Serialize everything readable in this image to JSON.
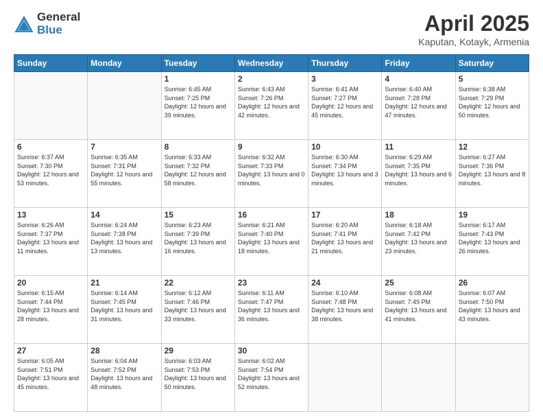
{
  "header": {
    "logo_general": "General",
    "logo_blue": "Blue",
    "title": "April 2025",
    "location": "Kaputan, Kotayk, Armenia"
  },
  "days_of_week": [
    "Sunday",
    "Monday",
    "Tuesday",
    "Wednesday",
    "Thursday",
    "Friday",
    "Saturday"
  ],
  "weeks": [
    [
      {
        "day": "",
        "info": ""
      },
      {
        "day": "",
        "info": ""
      },
      {
        "day": "1",
        "info": "Sunrise: 6:45 AM\nSunset: 7:25 PM\nDaylight: 12 hours and 39 minutes."
      },
      {
        "day": "2",
        "info": "Sunrise: 6:43 AM\nSunset: 7:26 PM\nDaylight: 12 hours and 42 minutes."
      },
      {
        "day": "3",
        "info": "Sunrise: 6:41 AM\nSunset: 7:27 PM\nDaylight: 12 hours and 45 minutes."
      },
      {
        "day": "4",
        "info": "Sunrise: 6:40 AM\nSunset: 7:28 PM\nDaylight: 12 hours and 47 minutes."
      },
      {
        "day": "5",
        "info": "Sunrise: 6:38 AM\nSunset: 7:29 PM\nDaylight: 12 hours and 50 minutes."
      }
    ],
    [
      {
        "day": "6",
        "info": "Sunrise: 6:37 AM\nSunset: 7:30 PM\nDaylight: 12 hours and 53 minutes."
      },
      {
        "day": "7",
        "info": "Sunrise: 6:35 AM\nSunset: 7:31 PM\nDaylight: 12 hours and 55 minutes."
      },
      {
        "day": "8",
        "info": "Sunrise: 6:33 AM\nSunset: 7:32 PM\nDaylight: 12 hours and 58 minutes."
      },
      {
        "day": "9",
        "info": "Sunrise: 6:32 AM\nSunset: 7:33 PM\nDaylight: 13 hours and 0 minutes."
      },
      {
        "day": "10",
        "info": "Sunrise: 6:30 AM\nSunset: 7:34 PM\nDaylight: 13 hours and 3 minutes."
      },
      {
        "day": "11",
        "info": "Sunrise: 6:29 AM\nSunset: 7:35 PM\nDaylight: 13 hours and 6 minutes."
      },
      {
        "day": "12",
        "info": "Sunrise: 6:27 AM\nSunset: 7:36 PM\nDaylight: 13 hours and 8 minutes."
      }
    ],
    [
      {
        "day": "13",
        "info": "Sunrise: 6:26 AM\nSunset: 7:37 PM\nDaylight: 13 hours and 11 minutes."
      },
      {
        "day": "14",
        "info": "Sunrise: 6:24 AM\nSunset: 7:38 PM\nDaylight: 13 hours and 13 minutes."
      },
      {
        "day": "15",
        "info": "Sunrise: 6:23 AM\nSunset: 7:39 PM\nDaylight: 13 hours and 16 minutes."
      },
      {
        "day": "16",
        "info": "Sunrise: 6:21 AM\nSunset: 7:40 PM\nDaylight: 13 hours and 18 minutes."
      },
      {
        "day": "17",
        "info": "Sunrise: 6:20 AM\nSunset: 7:41 PM\nDaylight: 13 hours and 21 minutes."
      },
      {
        "day": "18",
        "info": "Sunrise: 6:18 AM\nSunset: 7:42 PM\nDaylight: 13 hours and 23 minutes."
      },
      {
        "day": "19",
        "info": "Sunrise: 6:17 AM\nSunset: 7:43 PM\nDaylight: 13 hours and 26 minutes."
      }
    ],
    [
      {
        "day": "20",
        "info": "Sunrise: 6:15 AM\nSunset: 7:44 PM\nDaylight: 13 hours and 28 minutes."
      },
      {
        "day": "21",
        "info": "Sunrise: 6:14 AM\nSunset: 7:45 PM\nDaylight: 13 hours and 31 minutes."
      },
      {
        "day": "22",
        "info": "Sunrise: 6:12 AM\nSunset: 7:46 PM\nDaylight: 13 hours and 33 minutes."
      },
      {
        "day": "23",
        "info": "Sunrise: 6:11 AM\nSunset: 7:47 PM\nDaylight: 13 hours and 36 minutes."
      },
      {
        "day": "24",
        "info": "Sunrise: 6:10 AM\nSunset: 7:48 PM\nDaylight: 13 hours and 38 minutes."
      },
      {
        "day": "25",
        "info": "Sunrise: 6:08 AM\nSunset: 7:49 PM\nDaylight: 13 hours and 41 minutes."
      },
      {
        "day": "26",
        "info": "Sunrise: 6:07 AM\nSunset: 7:50 PM\nDaylight: 13 hours and 43 minutes."
      }
    ],
    [
      {
        "day": "27",
        "info": "Sunrise: 6:05 AM\nSunset: 7:51 PM\nDaylight: 13 hours and 45 minutes."
      },
      {
        "day": "28",
        "info": "Sunrise: 6:04 AM\nSunset: 7:52 PM\nDaylight: 13 hours and 48 minutes."
      },
      {
        "day": "29",
        "info": "Sunrise: 6:03 AM\nSunset: 7:53 PM\nDaylight: 13 hours and 50 minutes."
      },
      {
        "day": "30",
        "info": "Sunrise: 6:02 AM\nSunset: 7:54 PM\nDaylight: 13 hours and 52 minutes."
      },
      {
        "day": "",
        "info": ""
      },
      {
        "day": "",
        "info": ""
      },
      {
        "day": "",
        "info": ""
      }
    ]
  ]
}
